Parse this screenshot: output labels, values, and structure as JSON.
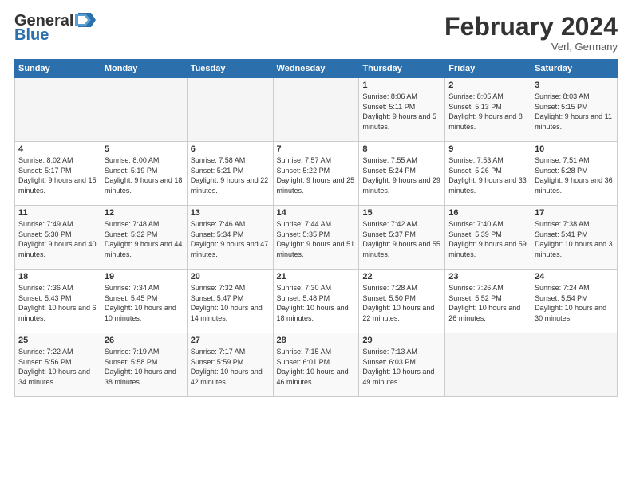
{
  "header": {
    "logo_general": "General",
    "logo_blue": "Blue",
    "month_title": "February 2024",
    "location": "Verl, Germany"
  },
  "days_of_week": [
    "Sunday",
    "Monday",
    "Tuesday",
    "Wednesday",
    "Thursday",
    "Friday",
    "Saturday"
  ],
  "weeks": [
    [
      {
        "day": "",
        "content": ""
      },
      {
        "day": "",
        "content": ""
      },
      {
        "day": "",
        "content": ""
      },
      {
        "day": "",
        "content": ""
      },
      {
        "day": "1",
        "content": "Sunrise: 8:06 AM\nSunset: 5:11 PM\nDaylight: 9 hours\nand 5 minutes."
      },
      {
        "day": "2",
        "content": "Sunrise: 8:05 AM\nSunset: 5:13 PM\nDaylight: 9 hours\nand 8 minutes."
      },
      {
        "day": "3",
        "content": "Sunrise: 8:03 AM\nSunset: 5:15 PM\nDaylight: 9 hours\nand 11 minutes."
      }
    ],
    [
      {
        "day": "4",
        "content": "Sunrise: 8:02 AM\nSunset: 5:17 PM\nDaylight: 9 hours\nand 15 minutes."
      },
      {
        "day": "5",
        "content": "Sunrise: 8:00 AM\nSunset: 5:19 PM\nDaylight: 9 hours\nand 18 minutes."
      },
      {
        "day": "6",
        "content": "Sunrise: 7:58 AM\nSunset: 5:21 PM\nDaylight: 9 hours\nand 22 minutes."
      },
      {
        "day": "7",
        "content": "Sunrise: 7:57 AM\nSunset: 5:22 PM\nDaylight: 9 hours\nand 25 minutes."
      },
      {
        "day": "8",
        "content": "Sunrise: 7:55 AM\nSunset: 5:24 PM\nDaylight: 9 hours\nand 29 minutes."
      },
      {
        "day": "9",
        "content": "Sunrise: 7:53 AM\nSunset: 5:26 PM\nDaylight: 9 hours\nand 33 minutes."
      },
      {
        "day": "10",
        "content": "Sunrise: 7:51 AM\nSunset: 5:28 PM\nDaylight: 9 hours\nand 36 minutes."
      }
    ],
    [
      {
        "day": "11",
        "content": "Sunrise: 7:49 AM\nSunset: 5:30 PM\nDaylight: 9 hours\nand 40 minutes."
      },
      {
        "day": "12",
        "content": "Sunrise: 7:48 AM\nSunset: 5:32 PM\nDaylight: 9 hours\nand 44 minutes."
      },
      {
        "day": "13",
        "content": "Sunrise: 7:46 AM\nSunset: 5:34 PM\nDaylight: 9 hours\nand 47 minutes."
      },
      {
        "day": "14",
        "content": "Sunrise: 7:44 AM\nSunset: 5:35 PM\nDaylight: 9 hours\nand 51 minutes."
      },
      {
        "day": "15",
        "content": "Sunrise: 7:42 AM\nSunset: 5:37 PM\nDaylight: 9 hours\nand 55 minutes."
      },
      {
        "day": "16",
        "content": "Sunrise: 7:40 AM\nSunset: 5:39 PM\nDaylight: 9 hours\nand 59 minutes."
      },
      {
        "day": "17",
        "content": "Sunrise: 7:38 AM\nSunset: 5:41 PM\nDaylight: 10 hours\nand 3 minutes."
      }
    ],
    [
      {
        "day": "18",
        "content": "Sunrise: 7:36 AM\nSunset: 5:43 PM\nDaylight: 10 hours\nand 6 minutes."
      },
      {
        "day": "19",
        "content": "Sunrise: 7:34 AM\nSunset: 5:45 PM\nDaylight: 10 hours\nand 10 minutes."
      },
      {
        "day": "20",
        "content": "Sunrise: 7:32 AM\nSunset: 5:47 PM\nDaylight: 10 hours\nand 14 minutes."
      },
      {
        "day": "21",
        "content": "Sunrise: 7:30 AM\nSunset: 5:48 PM\nDaylight: 10 hours\nand 18 minutes."
      },
      {
        "day": "22",
        "content": "Sunrise: 7:28 AM\nSunset: 5:50 PM\nDaylight: 10 hours\nand 22 minutes."
      },
      {
        "day": "23",
        "content": "Sunrise: 7:26 AM\nSunset: 5:52 PM\nDaylight: 10 hours\nand 26 minutes."
      },
      {
        "day": "24",
        "content": "Sunrise: 7:24 AM\nSunset: 5:54 PM\nDaylight: 10 hours\nand 30 minutes."
      }
    ],
    [
      {
        "day": "25",
        "content": "Sunrise: 7:22 AM\nSunset: 5:56 PM\nDaylight: 10 hours\nand 34 minutes."
      },
      {
        "day": "26",
        "content": "Sunrise: 7:19 AM\nSunset: 5:58 PM\nDaylight: 10 hours\nand 38 minutes."
      },
      {
        "day": "27",
        "content": "Sunrise: 7:17 AM\nSunset: 5:59 PM\nDaylight: 10 hours\nand 42 minutes."
      },
      {
        "day": "28",
        "content": "Sunrise: 7:15 AM\nSunset: 6:01 PM\nDaylight: 10 hours\nand 46 minutes."
      },
      {
        "day": "29",
        "content": "Sunrise: 7:13 AM\nSunset: 6:03 PM\nDaylight: 10 hours\nand 49 minutes."
      },
      {
        "day": "",
        "content": ""
      },
      {
        "day": "",
        "content": ""
      }
    ]
  ]
}
